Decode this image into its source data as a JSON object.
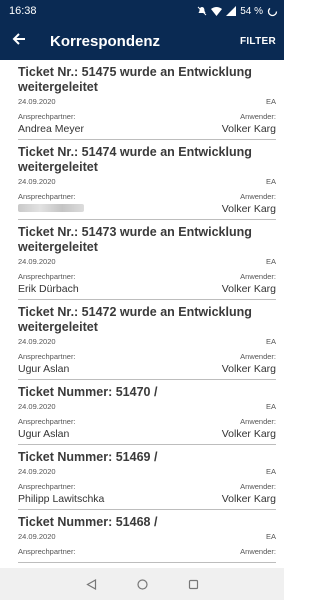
{
  "status": {
    "time": "16:38",
    "battery": "54 %"
  },
  "appbar": {
    "title": "Korrespondenz",
    "filter": "FILTER"
  },
  "tickets": [
    {
      "title": "Ticket Nr.: 51475 wurde an Entwicklung weitergeleitet",
      "date": "24.09.2020",
      "code": "EA",
      "contact_label": "Ansprechpartner:",
      "user_label": "Anwender:",
      "contact": "Andrea Meyer",
      "user": "Volker Karg"
    },
    {
      "title": "Ticket Nr.: 51474 wurde an Entwicklung weitergeleitet",
      "date": "24.09.2020",
      "code": "EA",
      "contact_label": "Ansprechpartner:",
      "user_label": "Anwender:",
      "contact": "",
      "user": "Volker Karg"
    },
    {
      "title": "Ticket Nr.: 51473 wurde an Entwicklung weitergeleitet",
      "date": "24.09.2020",
      "code": "EA",
      "contact_label": "Ansprechpartner:",
      "user_label": "Anwender:",
      "contact": "Erik Dürbach",
      "user": "Volker Karg"
    },
    {
      "title": "Ticket Nr.: 51472 wurde an Entwicklung weitergeleitet",
      "date": "24.09.2020",
      "code": "EA",
      "contact_label": "Ansprechpartner:",
      "user_label": "Anwender:",
      "contact": "Ugur Aslan",
      "user": "Volker Karg"
    },
    {
      "title": "Ticket Nummer: 51470 /",
      "date": "24.09.2020",
      "code": "EA",
      "contact_label": "Ansprechpartner:",
      "user_label": "Anwender:",
      "contact": "Ugur Aslan",
      "user": "Volker Karg"
    },
    {
      "title": "Ticket Nummer: 51469 /",
      "date": "24.09.2020",
      "code": "EA",
      "contact_label": "Ansprechpartner:",
      "user_label": "Anwender:",
      "contact": "Philipp Lawitschka",
      "user": "Volker Karg"
    },
    {
      "title": "Ticket Nummer: 51468 /",
      "date": "24.09.2020",
      "code": "EA",
      "contact_label": "Ansprechpartner:",
      "user_label": "Anwender:",
      "contact": "",
      "user": ""
    }
  ]
}
